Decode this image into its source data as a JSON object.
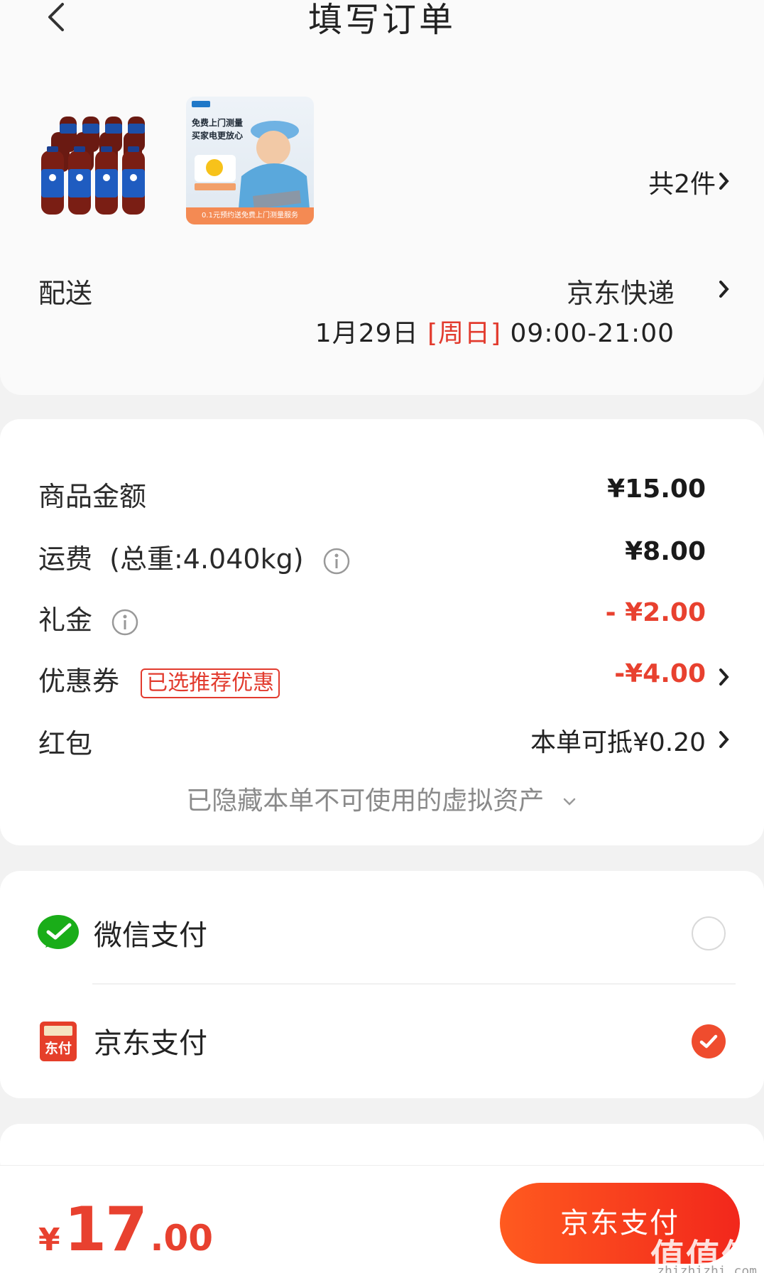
{
  "header": {
    "title": "填写订单"
  },
  "products": {
    "count_label": "共2件",
    "promo": {
      "line1": "免费上门测量",
      "line2": "买家电更放心",
      "bottom": "0.1元预约送免费上门测量服务"
    }
  },
  "delivery": {
    "label": "配送",
    "method": "京东快递",
    "date": "1月29日",
    "weekday": "[周日]",
    "time": "09:00-21:00"
  },
  "fees": {
    "goods_label": "商品金额",
    "goods_value": "¥15.00",
    "shipping_label": "运费  (总重:4.040kg)",
    "shipping_value": "¥8.00",
    "gift_label": "礼金",
    "gift_value": "- ¥2.00",
    "coupon_label": "优惠券",
    "coupon_badge": "已选推荐优惠",
    "coupon_value": "-¥4.00",
    "redpacket_label": "红包",
    "redpacket_value": "本单可抵¥0.20",
    "hidden_assets": "已隐藏本单不可使用的虚拟资产"
  },
  "payment": {
    "wechat_label": "微信支付",
    "wechat_selected": false,
    "jd_label": "京东支付",
    "jd_icon_text": "东付",
    "jd_selected": true
  },
  "footer": {
    "total_yen": "¥",
    "total_int": "17",
    "total_dec": ".00",
    "pay_button": "京东支付",
    "watermark": "值值值",
    "watermark_url": "zhizhizhi.com"
  },
  "colors": {
    "accent_red": "#e8412f",
    "wechat_green": "#1aad19",
    "pay_button_gradient": [
      "#ff5a1f",
      "#f2271c"
    ]
  }
}
